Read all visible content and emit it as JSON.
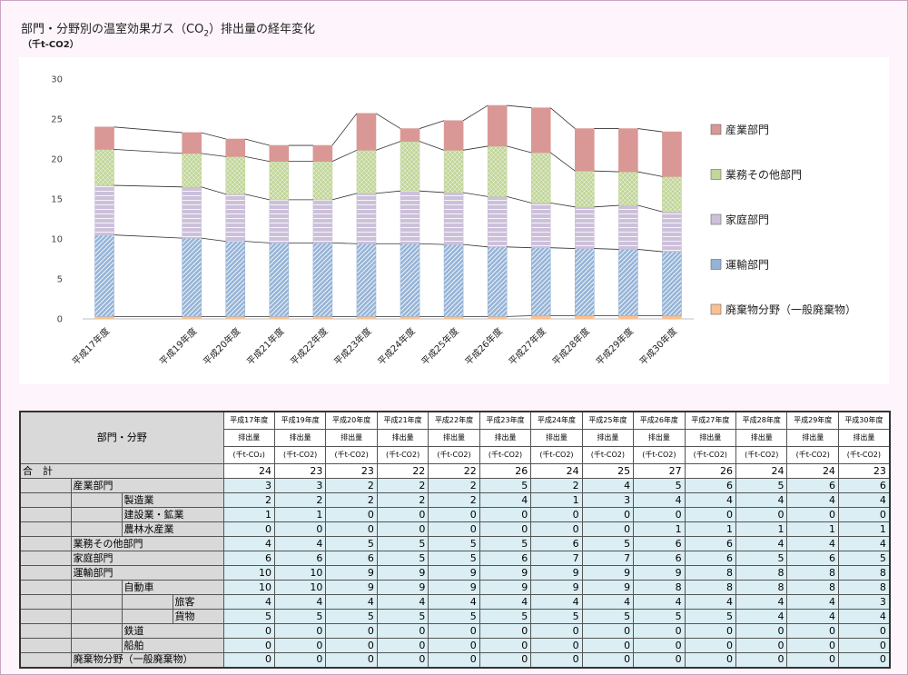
{
  "title": {
    "main": "部門・分野別の温室効果ガス（CO",
    "sub": "2",
    "tail": "）排出量の経年変化",
    "unit": "（千t-CO2）"
  },
  "colors": {
    "industry": "#d99795",
    "business": "#c3d69b",
    "household": "#ccc0da",
    "transport": "#95b3d7",
    "waste": "#fac090"
  },
  "chart_data": {
    "type": "bar",
    "stacked": true,
    "categories": [
      "平成17年度",
      "",
      "平成19年度",
      "平成20年度",
      "平成21年度",
      "平成22年度",
      "平成23年度",
      "平成24年度",
      "平成25年度",
      "平成26年度",
      "平成27年度",
      "平成28年度",
      "平成29年度",
      "平成30年度"
    ],
    "ylim": [
      0,
      30
    ],
    "yticks": [
      "0",
      "5",
      "10",
      "15",
      "20",
      "25",
      "30"
    ],
    "legend_position": "right",
    "series": [
      {
        "name": "廃棄物分野（一般廃棄物）",
        "key": "waste",
        "values": [
          0.3,
          null,
          0.3,
          0.3,
          0.3,
          0.3,
          0.3,
          0.3,
          0.3,
          0.3,
          0.4,
          0.4,
          0.4,
          0.4
        ]
      },
      {
        "name": "運輸部門",
        "key": "transport",
        "values": [
          10.2,
          null,
          9.8,
          9.4,
          9.2,
          9.2,
          9.1,
          9.1,
          9.0,
          8.7,
          8.5,
          8.4,
          8.3,
          8.0
        ]
      },
      {
        "name": "家庭部門",
        "key": "household",
        "values": [
          6.2,
          null,
          6.4,
          5.9,
          5.4,
          5.4,
          6.3,
          6.6,
          6.5,
          6.3,
          5.6,
          5.2,
          5.5,
          5.0
        ]
      },
      {
        "name": "業務その他部門",
        "key": "business",
        "values": [
          4.5,
          null,
          4.2,
          4.7,
          4.8,
          4.8,
          5.4,
          6.2,
          5.3,
          6.3,
          6.3,
          4.5,
          4.2,
          4.4
        ]
      },
      {
        "name": "産業部門",
        "key": "industry",
        "values": [
          2.8,
          null,
          2.6,
          2.2,
          2.0,
          2.0,
          4.6,
          1.6,
          3.7,
          5.1,
          5.6,
          5.3,
          5.4,
          5.6
        ]
      }
    ],
    "legend_order": [
      "産業部門",
      "業務その他部門",
      "家庭部門",
      "運輸部門",
      "廃棄物分野（一般廃棄物）"
    ]
  },
  "table": {
    "corner": "部門・分野",
    "columns": [
      {
        "year": "平成17年度",
        "label": "排出量",
        "unit": "(千t-CO₂)"
      },
      {
        "year": "平成19年度",
        "label": "排出量",
        "unit": "(千t-CO2)"
      },
      {
        "year": "平成20年度",
        "label": "排出量",
        "unit": "(千t-CO2)"
      },
      {
        "year": "平成21年度",
        "label": "排出量",
        "unit": "(千t-CO2)"
      },
      {
        "year": "平成22年度",
        "label": "排出量",
        "unit": "(千t-CO2)"
      },
      {
        "year": "平成23年度",
        "label": "排出量",
        "unit": "(千t-CO2)"
      },
      {
        "year": "平成24年度",
        "label": "排出量",
        "unit": "(千t-CO2)"
      },
      {
        "year": "平成25年度",
        "label": "排出量",
        "unit": "(千t-CO2)"
      },
      {
        "year": "平成26年度",
        "label": "排出量",
        "unit": "(千t-CO2)"
      },
      {
        "year": "平成27年度",
        "label": "排出量",
        "unit": "(千t-CO2)"
      },
      {
        "year": "平成28年度",
        "label": "排出量",
        "unit": "(千t-CO2)"
      },
      {
        "year": "平成29年度",
        "label": "排出量",
        "unit": "(千t-CO2)"
      },
      {
        "year": "平成30年度",
        "label": "排出量",
        "unit": "(千t-CO2)"
      }
    ],
    "rows": [
      {
        "level": 0,
        "label": "合　計",
        "values": [
          "24",
          "23",
          "23",
          "22",
          "22",
          "26",
          "24",
          "25",
          "27",
          "26",
          "24",
          "24",
          "23"
        ]
      },
      {
        "level": 1,
        "label": "産業部門",
        "values": [
          "3",
          "3",
          "2",
          "2",
          "2",
          "5",
          "2",
          "4",
          "5",
          "6",
          "5",
          "6",
          "6"
        ]
      },
      {
        "level": 2,
        "label": "製造業",
        "values": [
          "2",
          "2",
          "2",
          "2",
          "2",
          "4",
          "1",
          "3",
          "4",
          "4",
          "4",
          "4",
          "4"
        ]
      },
      {
        "level": 2,
        "label": "建設業・鉱業",
        "values": [
          "1",
          "1",
          "0",
          "0",
          "0",
          "0",
          "0",
          "0",
          "0",
          "0",
          "0",
          "0",
          "0"
        ]
      },
      {
        "level": 2,
        "label": "農林水産業",
        "values": [
          "0",
          "0",
          "0",
          "0",
          "0",
          "0",
          "0",
          "0",
          "1",
          "1",
          "1",
          "1",
          "1"
        ]
      },
      {
        "level": 1,
        "label": "業務その他部門",
        "values": [
          "4",
          "4",
          "5",
          "5",
          "5",
          "5",
          "6",
          "5",
          "6",
          "6",
          "4",
          "4",
          "4"
        ]
      },
      {
        "level": 1,
        "label": "家庭部門",
        "values": [
          "6",
          "6",
          "6",
          "5",
          "5",
          "6",
          "7",
          "7",
          "6",
          "6",
          "5",
          "6",
          "5"
        ]
      },
      {
        "level": 1,
        "label": "運輸部門",
        "values": [
          "10",
          "10",
          "9",
          "9",
          "9",
          "9",
          "9",
          "9",
          "9",
          "8",
          "8",
          "8",
          "8"
        ]
      },
      {
        "level": 2,
        "label": "自動車",
        "values": [
          "10",
          "10",
          "9",
          "9",
          "9",
          "9",
          "9",
          "9",
          "8",
          "8",
          "8",
          "8",
          "8"
        ]
      },
      {
        "level": 3,
        "label": "旅客",
        "values": [
          "4",
          "4",
          "4",
          "4",
          "4",
          "4",
          "4",
          "4",
          "4",
          "4",
          "4",
          "4",
          "3"
        ]
      },
      {
        "level": 3,
        "label": "貨物",
        "values": [
          "5",
          "5",
          "5",
          "5",
          "5",
          "5",
          "5",
          "5",
          "5",
          "5",
          "4",
          "4",
          "4"
        ]
      },
      {
        "level": 2,
        "label": "鉄道",
        "values": [
          "0",
          "0",
          "0",
          "0",
          "0",
          "0",
          "0",
          "0",
          "0",
          "0",
          "0",
          "0",
          "0"
        ]
      },
      {
        "level": 2,
        "label": "船舶",
        "values": [
          "0",
          "0",
          "0",
          "0",
          "0",
          "0",
          "0",
          "0",
          "0",
          "0",
          "0",
          "0",
          "0"
        ]
      },
      {
        "level": 1,
        "label": "廃棄物分野（一般廃棄物）",
        "values": [
          "0",
          "0",
          "0",
          "0",
          "0",
          "0",
          "0",
          "0",
          "0",
          "0",
          "0",
          "0",
          "0"
        ]
      }
    ]
  }
}
